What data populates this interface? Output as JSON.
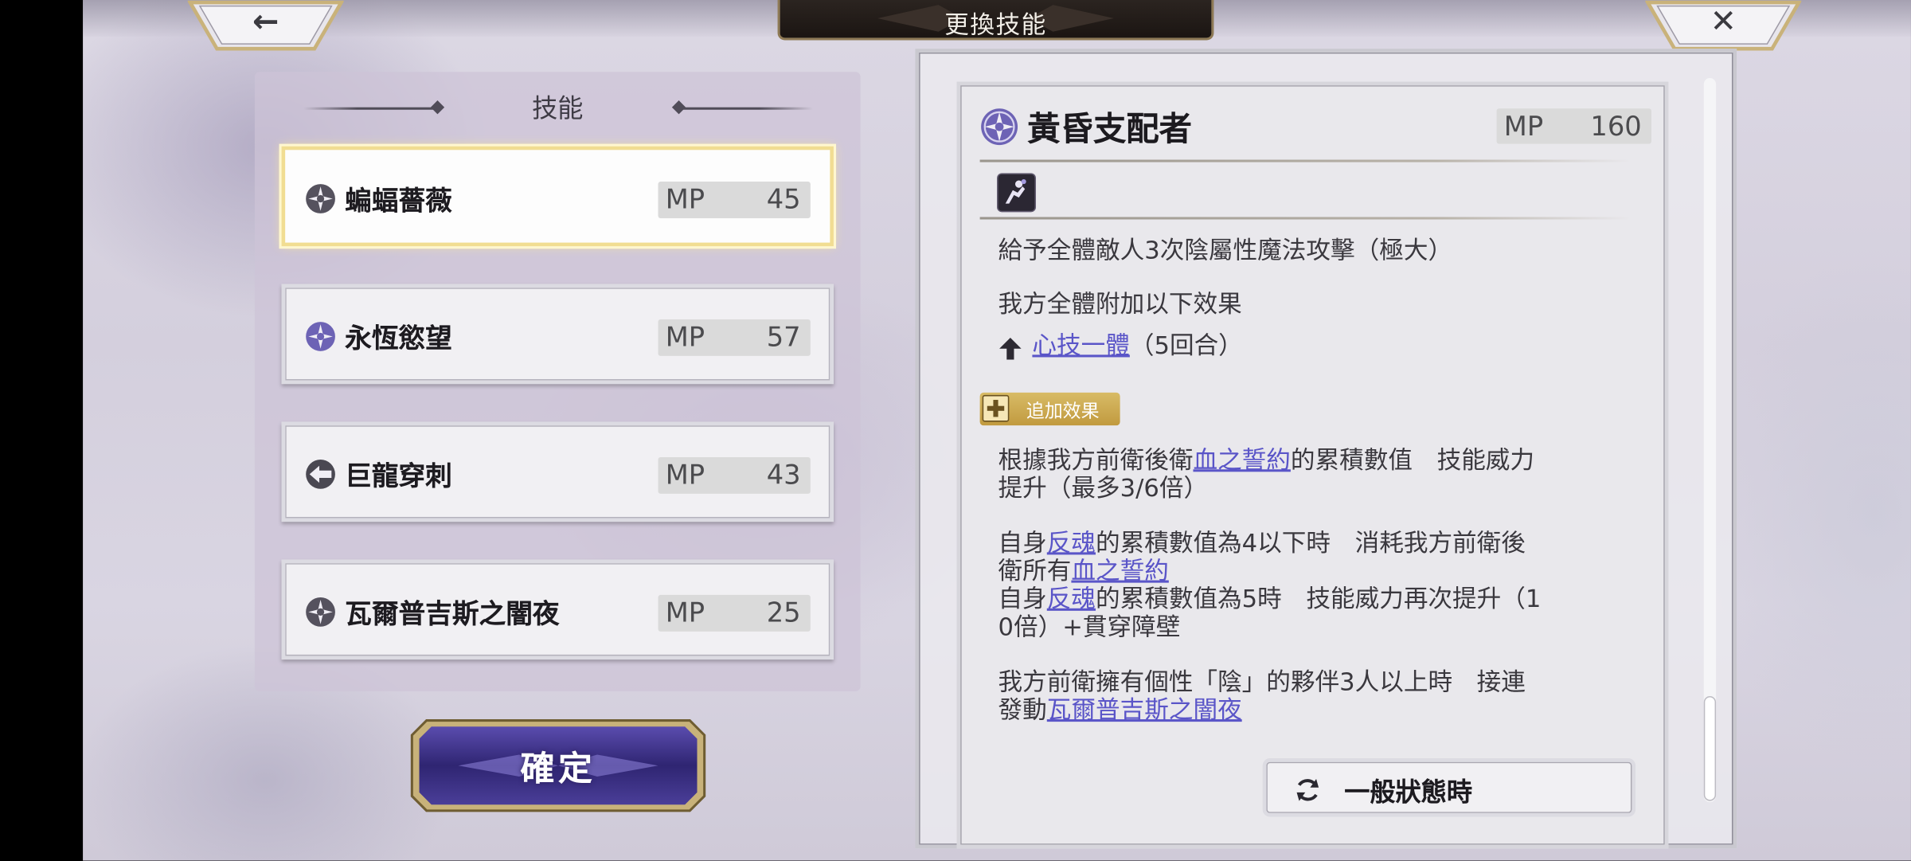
{
  "header": {
    "title": "更換技能",
    "back_glyph": "←",
    "close_glyph": "✕"
  },
  "skills_panel": {
    "heading": "技能",
    "items": [
      {
        "name": "蝙蝠薔薇",
        "mp_label": "MP",
        "mp": "45",
        "icon": "shadow-element-icon",
        "selected": true
      },
      {
        "name": "永恆慾望",
        "mp_label": "MP",
        "mp": "57",
        "icon": "shadow-element-icon",
        "selected": false
      },
      {
        "name": "巨龍穿刺",
        "mp_label": "MP",
        "mp": "43",
        "icon": "pierce-element-icon",
        "selected": false
      },
      {
        "name": "瓦爾普吉斯之闇夜",
        "mp_label": "MP",
        "mp": "25",
        "icon": "shadow-element-icon",
        "selected": false
      }
    ],
    "confirm_label": "確定"
  },
  "detail": {
    "name": "黃昏支配者",
    "mp_label": "MP",
    "mp": "160",
    "desc1": "給予全體敵人3次陰屬性魔法攻擊（極大）",
    "desc2": "我方全體附加以下效果",
    "buff_link": "心技一體",
    "buff_duration": "（5回合）",
    "bonus_badge": "追加效果",
    "p1_a": "根據我方前衛後衛",
    "p1_link": "血之誓約",
    "p1_b": "的累積數值　技能威力",
    "p1_c": "提升（最多3/6倍）",
    "p2_a": "自身",
    "p2_link1": "反魂",
    "p2_b": "的累積數值為4以下時　消耗我方前衛後",
    "p2_c": "衛所有",
    "p2_link2": "血之誓約",
    "p3_a": "自身",
    "p3_link": "反魂",
    "p3_b": "的累積數值為5時　技能威力再次提升（1",
    "p3_c": "0倍）+貫穿障壁",
    "p4_a": "我方前衛擁有個性「陰」的夥伴3人以上時　接連",
    "p4_b": "發動",
    "p4_link": "瓦爾普吉斯之闇夜",
    "state_button": "一般狀態時"
  },
  "colors": {
    "link": "#5a55c8",
    "selected_border": "#f1dd92",
    "badge": "#c9a449",
    "confirm_button": "#3b2f86"
  }
}
